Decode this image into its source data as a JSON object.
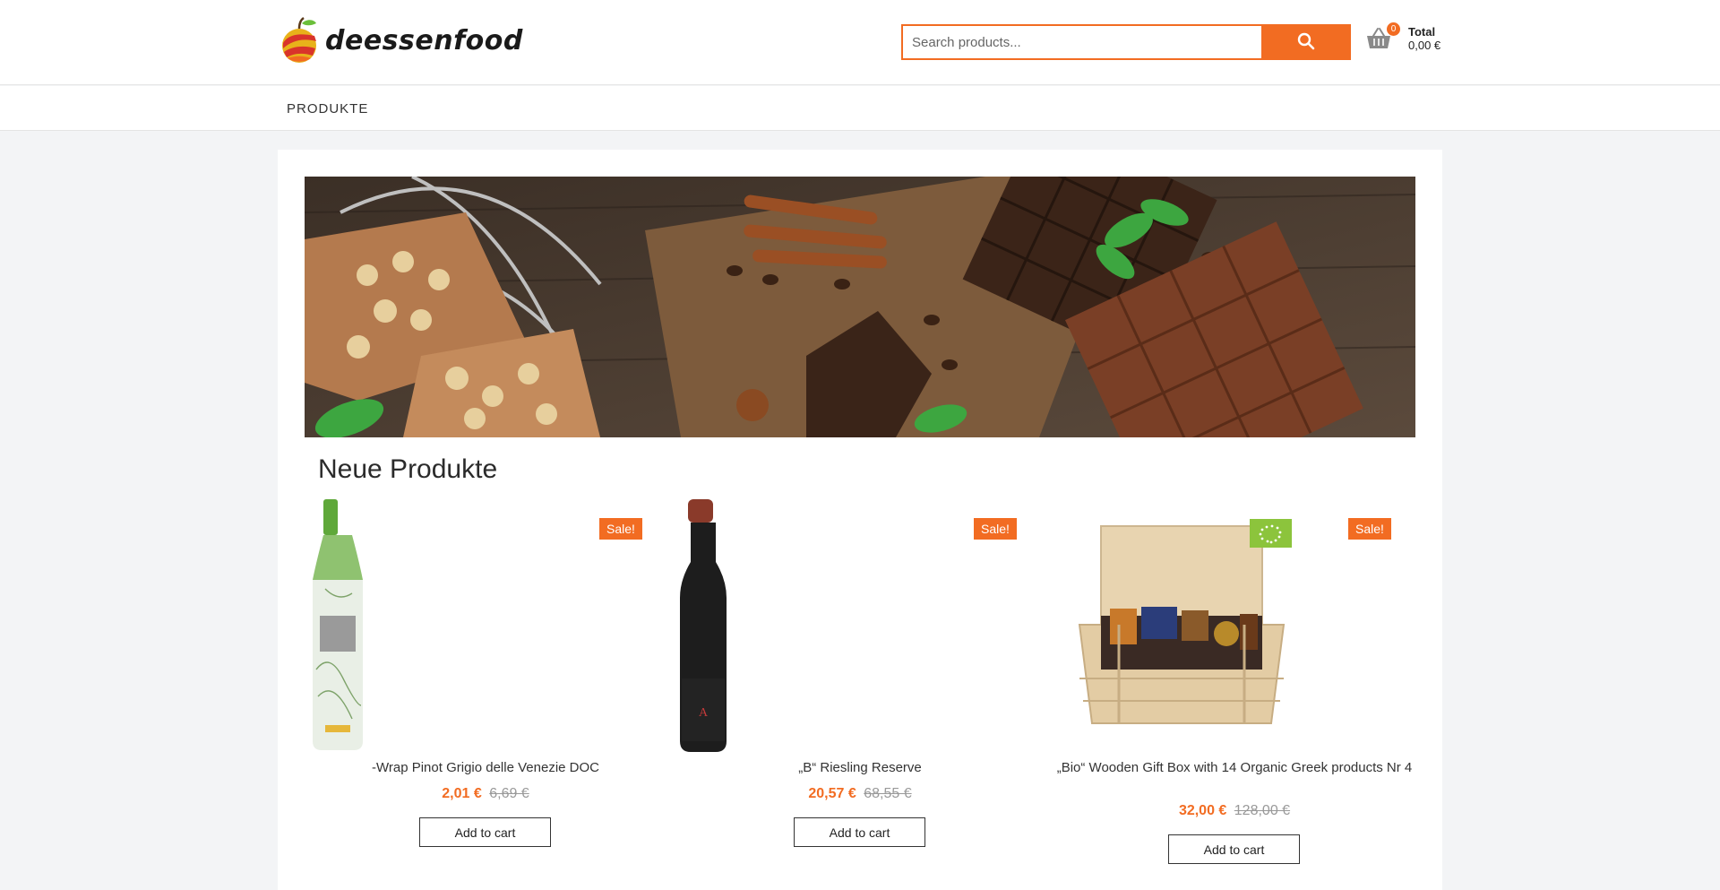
{
  "brand": {
    "name": "deessenfood",
    "accent": "#f26c22"
  },
  "search": {
    "placeholder": "Search products..."
  },
  "cart": {
    "count": "0",
    "total_label": "Total",
    "total_value": "0,00 €"
  },
  "nav": {
    "items": [
      {
        "label": "PRODUKTE"
      }
    ]
  },
  "section": {
    "title": "Neue Produkte"
  },
  "products": [
    {
      "name": "-Wrap Pinot Grigio delle Venezie DOC",
      "price": "2,01 €",
      "old_price": "6,69 €",
      "badge": "Sale!",
      "button": "Add to cart"
    },
    {
      "name": "„B“ Riesling Reserve",
      "price": "20,57 €",
      "old_price": "68,55 €",
      "badge": "Sale!",
      "button": "Add to cart"
    },
    {
      "name": "„Bio“ Wooden Gift Box with 14 Organic Greek products Nr 4",
      "price": "32,00 €",
      "old_price": "128,00 €",
      "badge": "Sale!",
      "button": "Add to cart"
    }
  ]
}
